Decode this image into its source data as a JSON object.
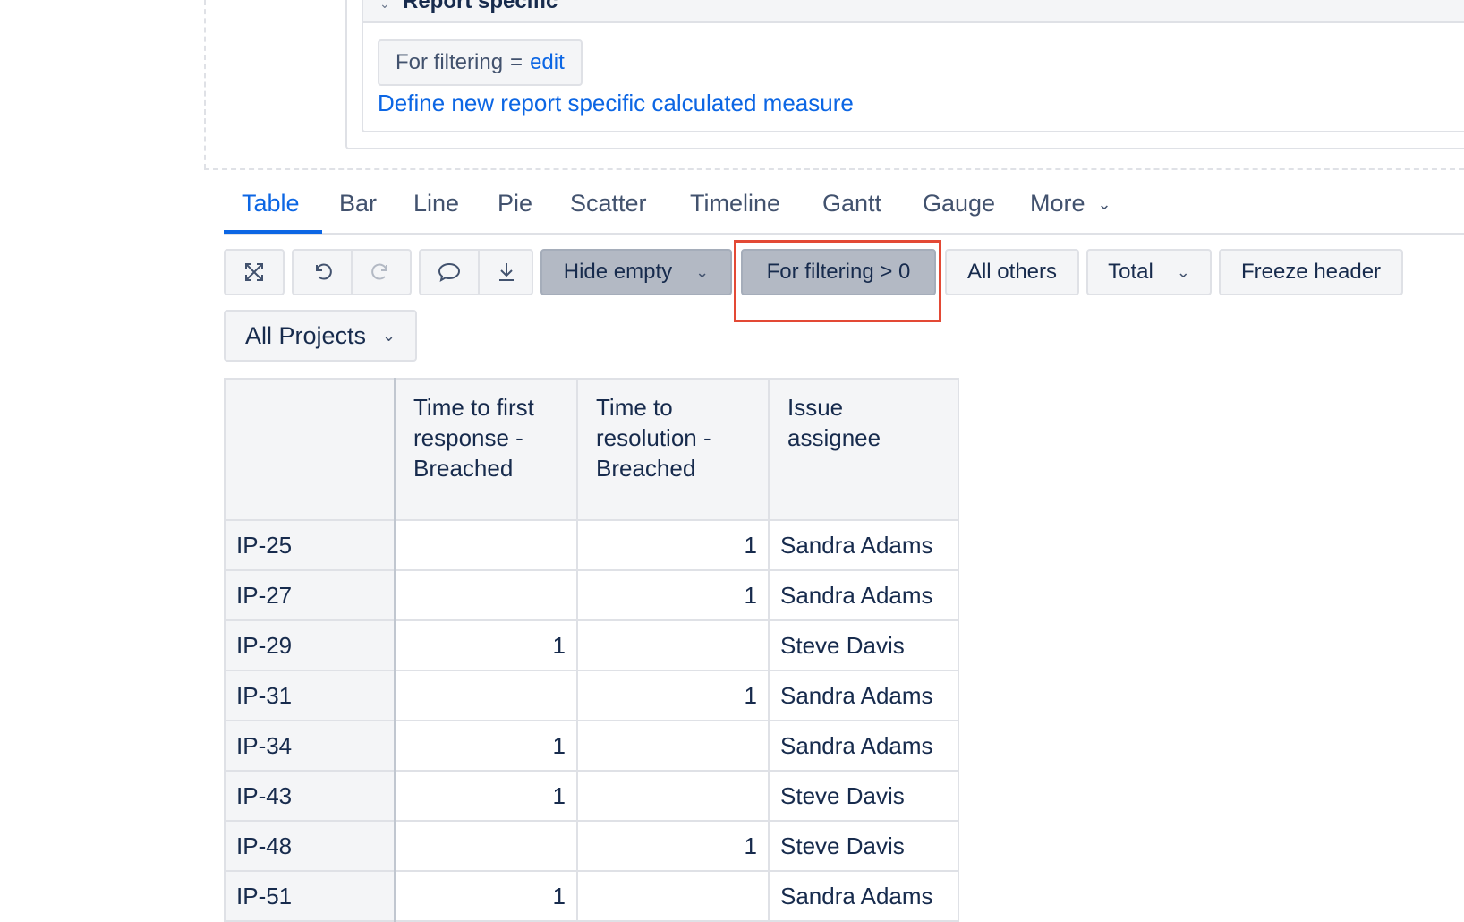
{
  "section": {
    "title": "Report specific"
  },
  "measure_chip": {
    "name": "For filtering",
    "eq": "=",
    "edit": "edit"
  },
  "define_link": "Define new report specific calculated measure",
  "tabs": [
    "Table",
    "Bar",
    "Line",
    "Pie",
    "Scatter",
    "Timeline",
    "Gantt",
    "Gauge",
    "More"
  ],
  "active_tab": "Table",
  "toolbar": {
    "hide_empty": "Hide empty",
    "filter": "For filtering > 0",
    "all_others": "All others",
    "total": "Total",
    "freeze_header": "Freeze header"
  },
  "projects_select": "All Projects",
  "table": {
    "headers": [
      "",
      "Time to first response - Breached",
      "Time to resolution - Breached",
      "Issue assignee"
    ],
    "rows": [
      {
        "key": "IP-25",
        "first": "",
        "resolution": "1",
        "assignee": "Sandra Adams"
      },
      {
        "key": "IP-27",
        "first": "",
        "resolution": "1",
        "assignee": "Sandra Adams"
      },
      {
        "key": "IP-29",
        "first": "1",
        "resolution": "",
        "assignee": "Steve Davis"
      },
      {
        "key": "IP-31",
        "first": "",
        "resolution": "1",
        "assignee": "Sandra Adams"
      },
      {
        "key": "IP-34",
        "first": "1",
        "resolution": "",
        "assignee": "Sandra Adams"
      },
      {
        "key": "IP-43",
        "first": "1",
        "resolution": "",
        "assignee": "Steve Davis"
      },
      {
        "key": "IP-48",
        "first": "",
        "resolution": "1",
        "assignee": "Steve Davis"
      },
      {
        "key": "IP-51",
        "first": "1",
        "resolution": "",
        "assignee": "Sandra Adams"
      }
    ]
  },
  "colors": {
    "link": "#0c66e4",
    "highlight": "#e34935",
    "pressed": "#b3b9c4"
  }
}
